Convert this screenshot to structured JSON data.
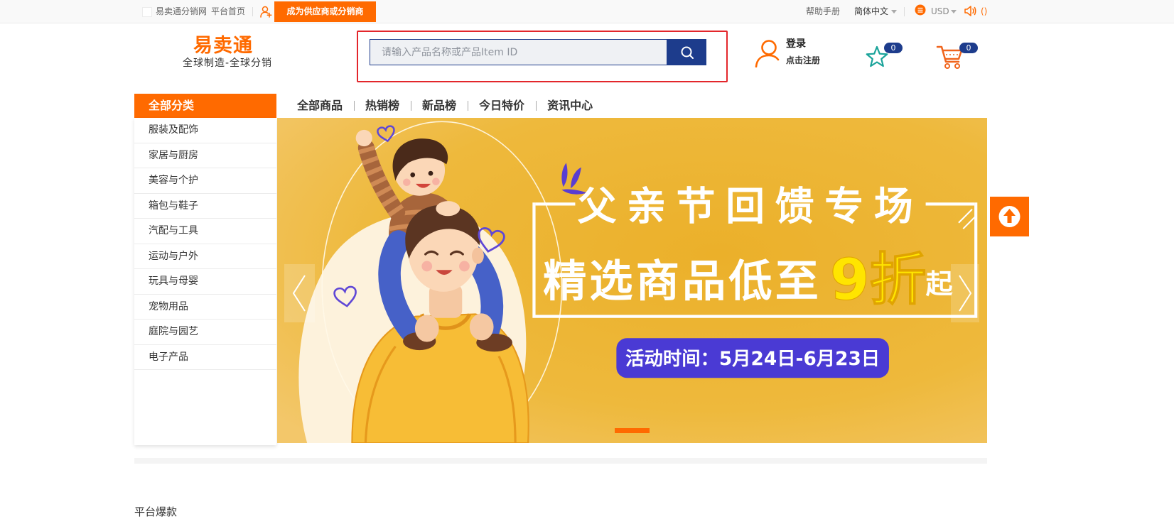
{
  "topbar": {
    "site_name": "易卖通分销网",
    "home_link": "平台首页",
    "join_button": "成为供应商或分销商",
    "help_link": "帮助手册",
    "language": "简体中文",
    "currency": "USD",
    "notice_count": "()"
  },
  "header": {
    "logo_text": "易卖通",
    "logo_slogan": "全球制造-全球分销",
    "search": {
      "placeholder": "请输入产品名称或产品Item ID",
      "value": ""
    },
    "account": {
      "login": "登录",
      "register": "点击注册"
    },
    "favorites_count": "0",
    "cart_count": "0"
  },
  "nav": {
    "category_title": "全部分类",
    "links": [
      "全部商品",
      "热销榜",
      "新品榜",
      "今日特价",
      "资讯中心"
    ]
  },
  "categories": [
    "服装及配饰",
    "家居与厨房",
    "美容与个护",
    "箱包与鞋子",
    "汽配与工具",
    "运动与户外",
    "玩具与母婴",
    "宠物用品",
    "庭院与园艺",
    "电子产品"
  ],
  "banner": {
    "title": "父亲节回馈专场",
    "promo_text": "精选商品低至",
    "promo_highlight": "9折",
    "promo_suffix": "起",
    "event_time": "活动时间：5月24日-6月23日"
  },
  "section": {
    "title": "平台爆款"
  },
  "icons": {
    "supplier": "add-user-icon",
    "coin": "coin-icon",
    "speaker": "speaker-icon",
    "dropdown": "chevron-down-icon",
    "search": "search-icon",
    "user": "user-icon",
    "favorites": "star-icon",
    "cart": "cart-icon",
    "banner_prev": "chevron-left-icon",
    "banner_next": "chevron-right-icon",
    "scroll_top": "arrow-up-icon"
  },
  "colors": {
    "brand_orange": "#ff6a00",
    "navy": "#1d3c8c",
    "teal": "#1aa39a",
    "annotation_red": "#e3262b",
    "banner_gold": "#eeb533",
    "banner_purple": "#4a3ad4",
    "promo_yellow": "#ffe500"
  }
}
